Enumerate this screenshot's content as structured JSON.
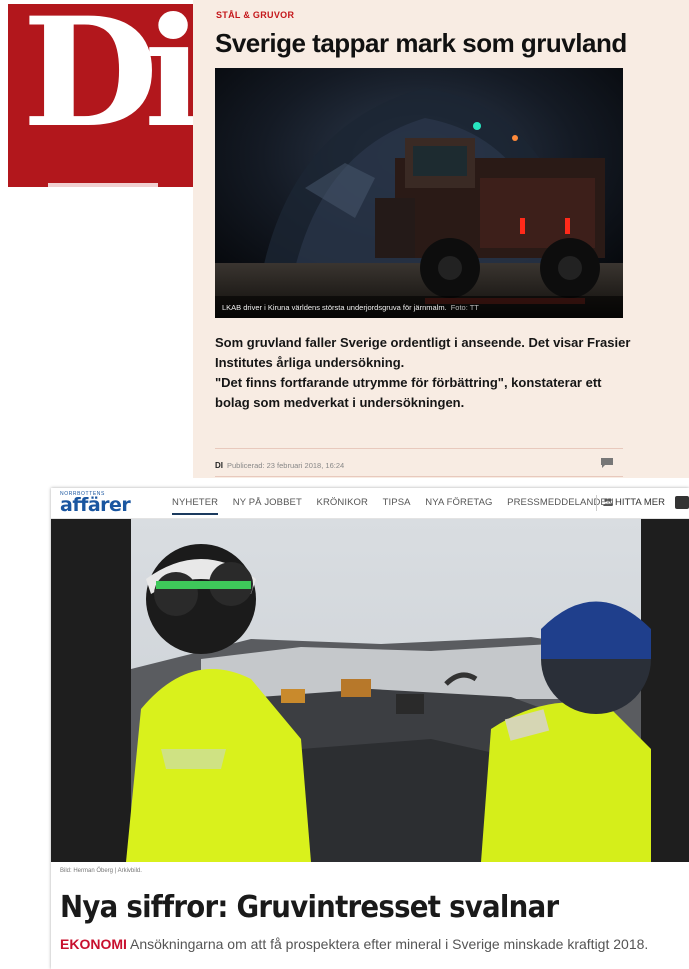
{
  "di": {
    "logo": "Di",
    "kicker": "STÅL & GRUVOR",
    "headline": "Sverige tappar mark som gruvland",
    "image_caption": "LKAB driver i Kiruna världens största underjordsgruva för järnmalm.",
    "image_credit": "Foto: TT",
    "body": [
      "Som gruvland faller Sverige ordentligt i anseende. Det visar Frasier Institutes årliga undersökning.",
      "\"Det finns fortfarande utrymme för förbättring\", konstaterar ett bolag som medverkat i undersökningen."
    ],
    "meta_brand": "DI",
    "meta_published": "Publicerad: 23 februari 2018, 16:24",
    "comment_icon": "comment-icon"
  },
  "na": {
    "logo_top": "NORRBOTTENS",
    "logo": "affärer",
    "nav": [
      "NYHETER",
      "NY PÅ JOBBET",
      "KRÖNIKOR",
      "TIPSA",
      "NYA FÖRETAG",
      "PRESSMEDDELANDEN"
    ],
    "hitta": "HITTA MER",
    "photo_credit": "Bild: Herman Öberg | Arkivbild.",
    "headline": "Nya siffror: Gruvintresset svalnar",
    "category": "EKONOMI",
    "lead": "Ansökningarna om att få prospektera efter mineral i Sverige minskade kraftigt 2018."
  },
  "colors": {
    "di_red": "#b2171c",
    "di_card_bg": "#f8ece3",
    "na_blue": "#1a56a0",
    "na_category": "#c8102e"
  }
}
